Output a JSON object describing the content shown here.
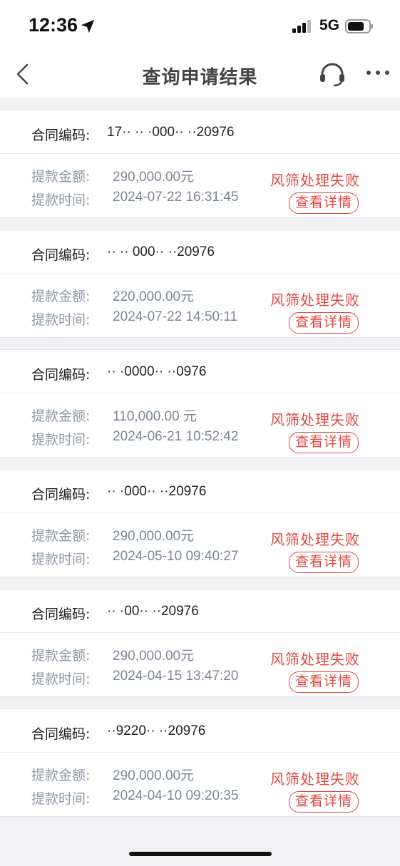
{
  "status_bar": {
    "time": "12:36",
    "network": "5G"
  },
  "nav": {
    "title": "查询申请结果"
  },
  "labels": {
    "contract": "合同编码:",
    "amount": "提款金额:",
    "time": "提款时间:",
    "detail_button": "查看详情"
  },
  "records": [
    {
      "contract_code": "17·· ·· ·000·· ··20976",
      "amount": "290,000.00元",
      "time": "2024-07-22 16:31:45",
      "status": "风筛处理失败"
    },
    {
      "contract_code": "·· ·· 000·· ··20976",
      "amount": "220,000.00元",
      "time": "2024-07-22 14:50:11",
      "status": "风筛处理失败"
    },
    {
      "contract_code": "·· ·0000·· ··0976",
      "amount": "110,000.00 元",
      "time": "2024-06-21 10:52:42",
      "status": "风筛处理失败"
    },
    {
      "contract_code": "·· ·000·· ··20976",
      "amount": "290,000.00元",
      "time": "2024-05-10 09:40:27",
      "status": "风筛处理失败"
    },
    {
      "contract_code": "·· ·00·· ··20976",
      "amount": "290,000.00元",
      "time": "2024-04-15 13:47:20",
      "status": "风筛处理失败"
    },
    {
      "contract_code": "··9220·· ··20976",
      "amount": "290,000.00元",
      "time": "2024-04-10 09:20:35",
      "status": "风筛处理失败"
    }
  ],
  "colors": {
    "status_red": "#e2483f",
    "label_gray": "#8f9aa6"
  }
}
